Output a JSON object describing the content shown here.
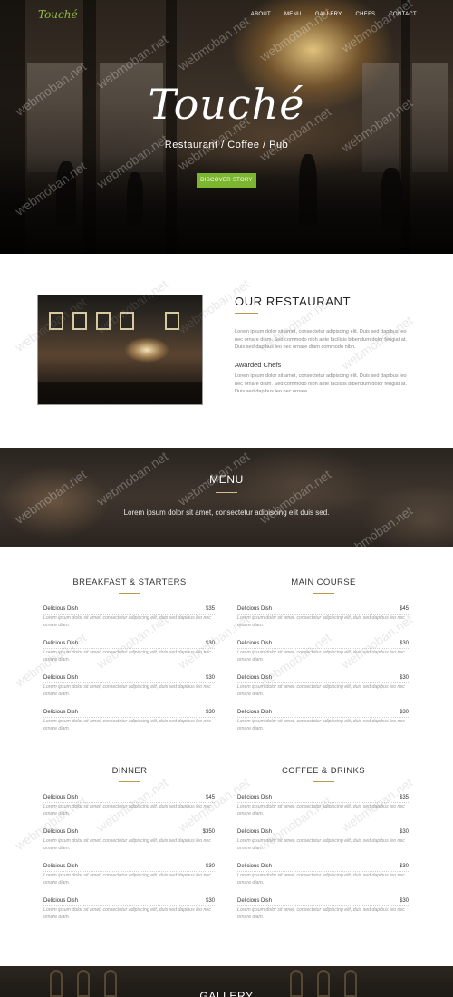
{
  "brand": {
    "logo": "Touché"
  },
  "nav": {
    "items": [
      "ABOUT",
      "MENU",
      "GALLERY",
      "CHEFS",
      "CONTACT"
    ]
  },
  "hero": {
    "title": "Touché",
    "subtitle": "Restaurant / Coffee / Pub",
    "button": "DISCOVER STORY"
  },
  "about": {
    "title": "OUR RESTAURANT",
    "paragraph1": "Lorem ipsum dolor sit amet, consectetur adipiscing elit. Duis sed dapibus leo nec ornare diam. Sed commodo nibh ante facilisis bibendum dolor feugiat at. Duis sed dapibus leo nec ornare diam commodo nibh.",
    "subheading": "Awarded Chefs",
    "paragraph2": "Lorem ipsum dolor sit amet, consectetur adipiscing elit. Duis sed dapibus leo nec ornare diam. Sed commodo nibh ante facilisis bibendum dolor feugiat at. Duis sed dapibus leo nec ornare."
  },
  "menu_banner": {
    "title": "MENU",
    "subtitle": "Lorem ipsum dolor sit amet, consectetur adipiscing elit duis sed."
  },
  "menu_sections": [
    {
      "title": "BREAKFAST & STARTERS",
      "items": [
        {
          "name": "Delicious Dish",
          "price": "$35",
          "desc": "Lorem ipsum dolor sit amet, consectetur adipiscing elit, duis sed dapibus leo nec ornare diam."
        },
        {
          "name": "Delicious Dish",
          "price": "$30",
          "desc": "Lorem ipsum dolor sit amet, consectetur adipiscing elit, duis sed dapibus leo nec ornare diam."
        },
        {
          "name": "Delicious Dish",
          "price": "$30",
          "desc": "Lorem ipsum dolor sit amet, consectetur adipiscing elit, duis sed dapibus leo nec ornare diam."
        },
        {
          "name": "Delicious Dish",
          "price": "$30",
          "desc": "Lorem ipsum dolor sit amet, consectetur adipiscing elit, duis sed dapibus leo nec ornare diam."
        }
      ]
    },
    {
      "title": "MAIN COURSE",
      "items": [
        {
          "name": "Delicious Dish",
          "price": "$45",
          "desc": "Lorem ipsum dolor sit amet, consectetur adipiscing elit, duis sed dapibus leo nec ornare diam."
        },
        {
          "name": "Delicious Dish",
          "price": "$30",
          "desc": "Lorem ipsum dolor sit amet, consectetur adipiscing elit, duis sed dapibus leo nec ornare diam."
        },
        {
          "name": "Delicious Dish",
          "price": "$30",
          "desc": "Lorem ipsum dolor sit amet, consectetur adipiscing elit, duis sed dapibus leo nec ornare diam."
        },
        {
          "name": "Delicious Dish",
          "price": "$30",
          "desc": "Lorem ipsum dolor sit amet, consectetur adipiscing elit, duis sed dapibus leo nec ornare diam."
        }
      ]
    },
    {
      "title": "DINNER",
      "items": [
        {
          "name": "Delicious Dish",
          "price": "$45",
          "desc": "Lorem ipsum dolor sit amet, consectetur adipiscing elit, duis sed dapibus leo nec ornare diam."
        },
        {
          "name": "Delicious Dish",
          "price": "$350",
          "desc": "Lorem ipsum dolor sit amet, consectetur adipiscing elit, duis sed dapibus leo nec ornare diam."
        },
        {
          "name": "Delicious Dish",
          "price": "$30",
          "desc": "Lorem ipsum dolor sit amet, consectetur adipiscing elit, duis sed dapibus leo nec ornare diam."
        },
        {
          "name": "Delicious Dish",
          "price": "$30",
          "desc": "Lorem ipsum dolor sit amet, consectetur adipiscing elit, duis sed dapibus leo nec ornare diam."
        }
      ]
    },
    {
      "title": "COFFEE & DRINKS",
      "items": [
        {
          "name": "Delicious Dish",
          "price": "$35",
          "desc": "Lorem ipsum dolor sit amet, consectetur adipiscing elit, duis sed dapibus leo nec ornare diam."
        },
        {
          "name": "Delicious Dish",
          "price": "$30",
          "desc": "Lorem ipsum dolor sit amet, consectetur adipiscing elit, duis sed dapibus leo nec ornare diam."
        },
        {
          "name": "Delicious Dish",
          "price": "$30",
          "desc": "Lorem ipsum dolor sit amet, consectetur adipiscing elit, duis sed dapibus leo nec ornare diam."
        },
        {
          "name": "Delicious Dish",
          "price": "$30",
          "desc": "Lorem ipsum dolor sit amet, consectetur adipiscing elit, duis sed dapibus leo nec ornare diam."
        }
      ]
    }
  ],
  "gallery": {
    "title": "GALLERY"
  },
  "watermark": "webmoban.net",
  "colors": {
    "accent": "#7cb52f",
    "gold_rule": "#b89a4a"
  }
}
